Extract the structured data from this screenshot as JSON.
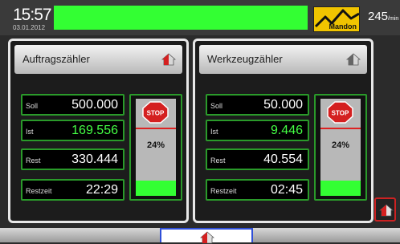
{
  "header": {
    "time": "15:57",
    "date": "03.01.2012",
    "logo_text": "Mandon",
    "rate_value": "245",
    "rate_unit": "/min"
  },
  "panels": [
    {
      "title": "Auftragszähler",
      "rows": [
        {
          "label": "Soll",
          "value": "500.000"
        },
        {
          "label": "Ist",
          "value": "169.556"
        },
        {
          "label": "Rest",
          "value": "330.444"
        },
        {
          "label": "Restzeit",
          "value": "22:29"
        }
      ],
      "stop_text": "STOP",
      "percent": "24%",
      "fill_fraction": 0.16
    },
    {
      "title": "Werkzeugzähler",
      "rows": [
        {
          "label": "Soll",
          "value": "50.000"
        },
        {
          "label": "Ist",
          "value": "9.446"
        },
        {
          "label": "Rest",
          "value": "40.554"
        },
        {
          "label": "Restzeit",
          "value": "02:45"
        }
      ],
      "stop_text": "STOP",
      "percent": "24%",
      "fill_fraction": 0.16
    }
  ],
  "icons": {
    "panel_home": "house-icon",
    "side_home": "house-icon",
    "bottom_home": "house-icon",
    "stop": "stop-sign-icon"
  },
  "colors": {
    "status_green": "#33ff33",
    "frame_green": "#2a9a2a",
    "stop_red": "#d22222",
    "logo_yellow": "#f0c400"
  }
}
